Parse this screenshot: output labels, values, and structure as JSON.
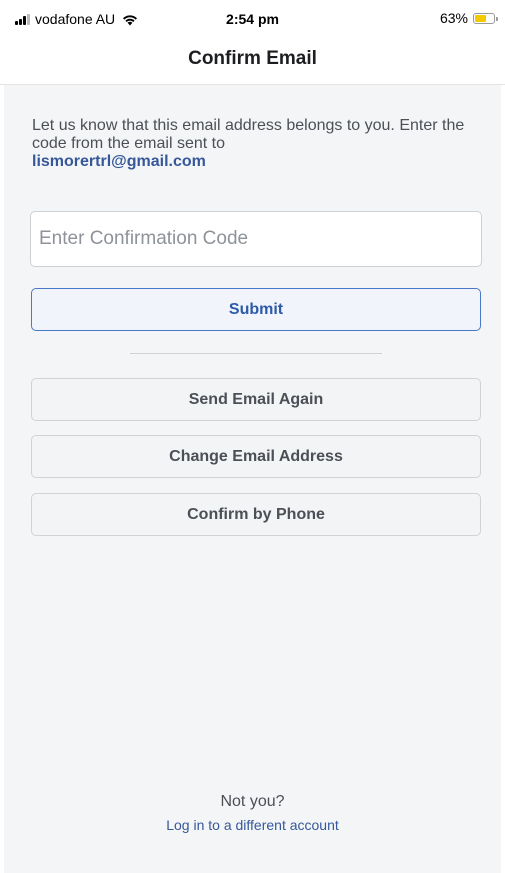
{
  "status_bar": {
    "carrier": "vodafone AU",
    "time": "2:54 pm",
    "battery_percent": "63%",
    "battery_level": 0.63,
    "signal_icon": "cellular-signal-icon",
    "wifi_icon": "wifi-icon",
    "battery_icon": "battery-icon",
    "battery_color": "#f5c900"
  },
  "header": {
    "title": "Confirm Email"
  },
  "main": {
    "intro_text": "Let us know that this email address belongs to you. Enter the code from the email sent to",
    "email": "lismorertrl@gmail.com",
    "code_input": {
      "placeholder": "Enter Confirmation Code",
      "value": ""
    },
    "submit_label": "Submit",
    "send_again_label": "Send Email Again",
    "change_email_label": "Change Email Address",
    "confirm_phone_label": "Confirm by Phone"
  },
  "footer": {
    "not_you": "Not you?",
    "different_account": "Log in to a different account"
  },
  "colors": {
    "accent": "#365899",
    "submit_border": "#4a78c9",
    "background": "#f4f5f7"
  }
}
